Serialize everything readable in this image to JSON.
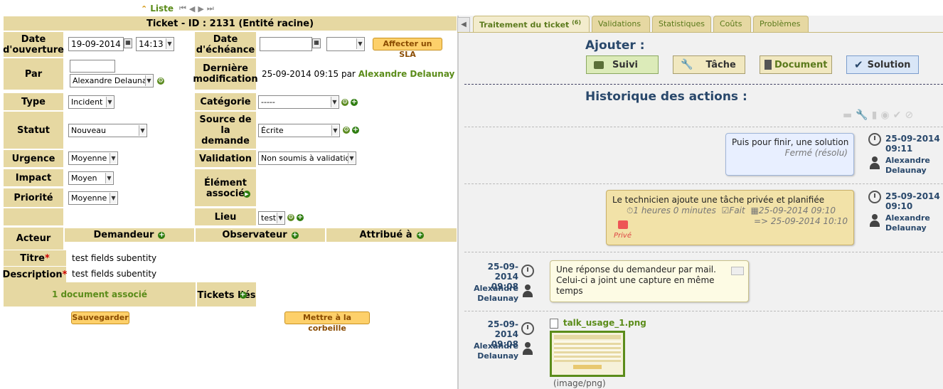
{
  "nav": {
    "liste": "Liste",
    "icons": [
      "first-icon",
      "prev-icon",
      "next-icon",
      "last-icon"
    ]
  },
  "ticket": {
    "title": "Ticket - ID : 2131 (Entité racine)",
    "date_ouverture_label": "Date d'ouverture",
    "date_ouverture": "19-09-2014",
    "heure_ouverture": "14:13",
    "date_echeance_label": "Date d'échéance",
    "date_echeance": "",
    "heure_echeance": "",
    "sla_button": "Affecter un SLA",
    "par_label": "Par",
    "par_value": "Alexandre Delaunay",
    "derniere_modif_label": "Dernière modification",
    "derniere_modif_date": "25-09-2014 09:15 par",
    "derniere_modif_user": "Alexandre Delaunay",
    "type_label": "Type",
    "type_value": "Incident",
    "categorie_label": "Catégorie",
    "categorie_value": "-----",
    "statut_label": "Statut",
    "statut_value": "Nouveau",
    "source_label": "Source de la demande",
    "source_value": "Écrite",
    "urgence_label": "Urgence",
    "urgence_value": "Moyenne",
    "validation_label": "Validation",
    "validation_value": "Non soumis à validation",
    "impact_label": "Impact",
    "impact_value": "Moyen",
    "element_label": "Élément associé",
    "priorite_label": "Priorité",
    "priorite_value": "Moyenne",
    "lieu_label": "Lieu",
    "lieu_value": "test",
    "acteur_label": "Acteur",
    "demandeur_label": "Demandeur",
    "observateur_label": "Observateur",
    "attribue_label": "Attribué à",
    "titre_label": "Titre",
    "titre_value": "test fields subentity",
    "description_label": "Description",
    "description_value": "test fields subentity",
    "documents": "1 document associé",
    "tickets_lies_label": "Tickets liés",
    "save_button": "Sauvegarder",
    "trash_button": "Mettre à la corbeille"
  },
  "tabs": [
    {
      "label": "Traitement du ticket",
      "count": "(6)"
    },
    {
      "label": "Validations"
    },
    {
      "label": "Statistiques"
    },
    {
      "label": "Coûts"
    },
    {
      "label": "Problèmes"
    }
  ],
  "actions": {
    "title": "Ajouter :",
    "suivi": "Suivi",
    "tache": "Tâche",
    "document": "Document",
    "solution": "Solution"
  },
  "history": {
    "title": "Historique des actions :",
    "filter_icons": [
      "comment-icon",
      "wrench-icon",
      "document-icon",
      "check-circle-icon",
      "check-icon",
      "ban-icon"
    ],
    "items": [
      {
        "text": "Puis pour finir, une solution",
        "sub": "Fermé (résolu)",
        "date": "25-09-2014",
        "time": "09:11",
        "user_first": "Alexandre",
        "user_last": "Delaunay"
      },
      {
        "text": "Le technicien ajoute une tâche privée et planifiée",
        "duration": "1 heures 0 minutes",
        "done": "Fait",
        "planned_start": "25-09-2014 09:10",
        "planned_end": "=> 25-09-2014 10:10",
        "private": "Privé",
        "date": "25-09-2014",
        "time": "09:10",
        "user_first": "Alexandre",
        "user_last": "Delaunay"
      },
      {
        "text": "Une réponse du demandeur par mail. Celui-ci a joint une capture en même temps",
        "date": "25-09-2014",
        "time": "09:08",
        "user_first": "Alexandre",
        "user_last": "Delaunay"
      },
      {
        "file": "talk_usage_1.png",
        "mime": "(image/png)",
        "date": "25-09-2014",
        "time": "09:08",
        "user_first": "Alexandre",
        "user_last": "Delaunay"
      }
    ]
  },
  "colors": {
    "label_bg": "#e6d8a2",
    "link_green": "#5b8c1a",
    "history_blue": "#29486b",
    "solution_bubble": "#e8efff",
    "task_bubble": "#f2e2a8",
    "followup_bubble": "#fdfbe4"
  }
}
